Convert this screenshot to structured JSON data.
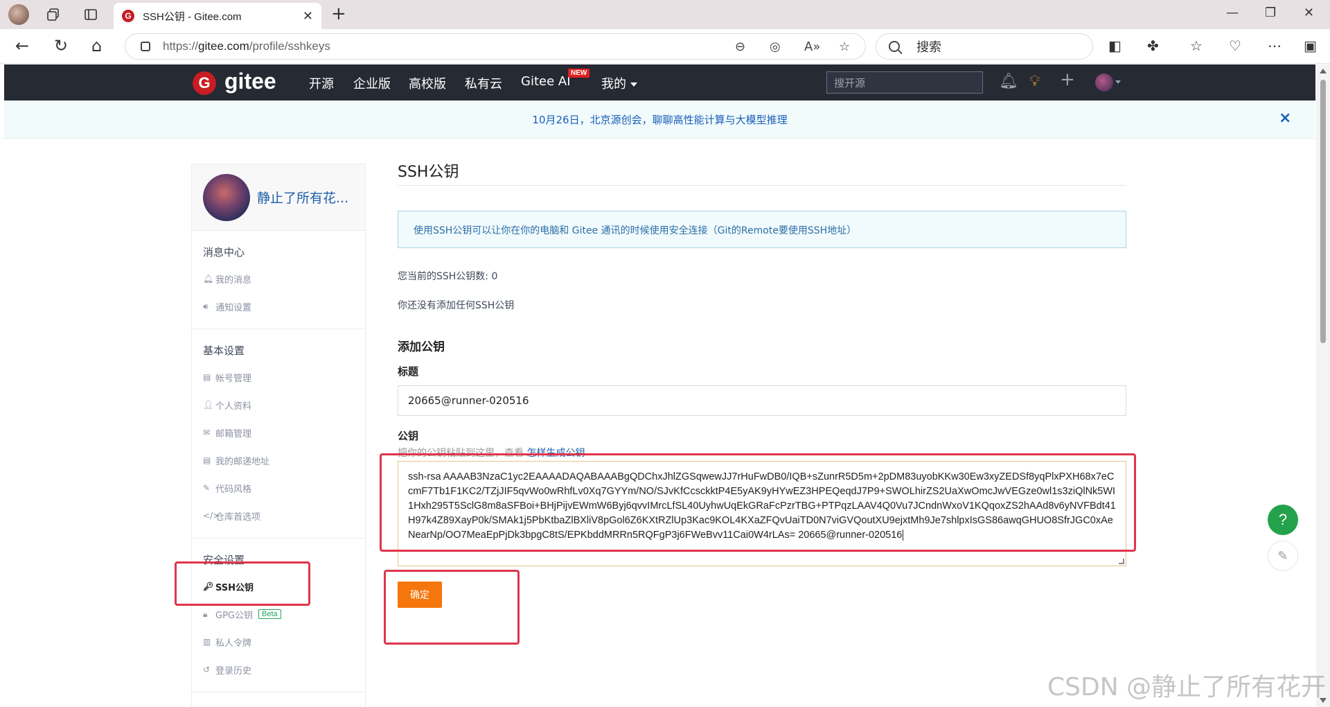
{
  "browser": {
    "tab_title": "SSH公钥 - Gitee.com",
    "tab_favicon": "G",
    "url_prefix": "https://",
    "url_host": "gitee.com",
    "url_path": "/profile/sshkeys",
    "search_placeholder": "搜索"
  },
  "header": {
    "logo_letter": "G",
    "logo_text": "gitee",
    "nav": [
      "开源",
      "企业版",
      "高校版",
      "私有云",
      "Gitee AI",
      "我的"
    ],
    "new_badge": "NEW",
    "search_placeholder": "搜开源"
  },
  "announcement": {
    "text": "10月26日，北京源创会，聊聊高性能计算与大模型推理",
    "close": "×"
  },
  "sidebar": {
    "username": "静止了所有花...",
    "sections": [
      {
        "title": "消息中心",
        "items": [
          {
            "label": "我的消息",
            "icon": "bell-icon"
          },
          {
            "label": "通知设置",
            "icon": "speaker-icon"
          }
        ]
      },
      {
        "title": "基本设置",
        "items": [
          {
            "label": "帐号管理",
            "icon": "id-card-icon"
          },
          {
            "label": "个人资料",
            "icon": "user-icon"
          },
          {
            "label": "邮箱管理",
            "icon": "mail-icon"
          },
          {
            "label": "我的邮递地址",
            "icon": "address-card-icon"
          },
          {
            "label": "代码风格",
            "icon": "brush-icon"
          },
          {
            "label": "仓库首选项",
            "icon": "code-icon"
          }
        ]
      },
      {
        "title": "安全设置",
        "items": [
          {
            "label": "SSH公钥",
            "icon": "key-icon",
            "active": true
          },
          {
            "label": "GPG公钥",
            "icon": "lock-icon",
            "badge": "Beta"
          },
          {
            "label": "私人令牌",
            "icon": "token-icon"
          },
          {
            "label": "登录历史",
            "icon": "history-icon"
          }
        ]
      }
    ]
  },
  "main": {
    "title": "SSH公钥",
    "tip": "使用SSH公钥可以让你在你的电脑和 Gitee 通讯的时候使用安全连接（Git的Remote要使用SSH地址）",
    "count": "您当前的SSH公钥数: 0",
    "none": "你还没有添加任何SSH公钥",
    "add_title": "添加公钥",
    "title_label": "标题",
    "title_value": "20665@runner-020516",
    "key_label": "公钥",
    "key_hint": "把你的公钥粘贴到这里，查看",
    "key_hint_link": "怎样生成公钥",
    "key_value": "ssh-rsa AAAAB3NzaC1yc2EAAAADAQABAAABgQDChxJhlZGSqwewJJ7rHuFwDB0/IQB+sZunrR5D5m+2pDM83uyobKKw30Ew3xyZEDSf8yqPlxPXH68x7eCcmF7Tb1F1KC2/TZjJIF5qvWo0wRhfLv0Xq7GYYm/NO/SJvKfCcsckktP4E5yAK9yHYwEZ3HPEQeqdJ7P9+SWOLhirZS2UaXwOmcJwVEGze0wl1s3ziQlNk5WI1Hxh295T5SclG8m8aSFBoi+BHjPijvEWmW6Byj6qvvIMrcLfSL40UyhwUqEkGRaFcPzrTBG+PTPqzLAAV4Q0Vu7JCndnWxoV1KQqoxZS2hAAd8v6yNVFBdt41H97k4Z89XayP0k/SMAk1j5PbKtbaZlBXliV8pGol6Z6KXtRZlUp3Kac9KOL4KXaZFQvUaiTD0N7viGVQoutXU9ejxtMh9Je7shlpxIsGS86awqGHUO8SfrJGC0xAeNearNp/OO7MeaEpPjDk3bpgC8tS/EPKbddMRRn5RQFgP3j6FWeBvv11Cai0W4rLAs= 20665@runner-020516",
    "confirm": "确定"
  },
  "float": {
    "help": "?"
  },
  "watermark": "CSDN @静止了所有花开",
  "colors": {
    "brand": "#c71d23",
    "header_bg": "#262a33",
    "confirm": "#f5760c",
    "annotation": "#e0344c"
  }
}
